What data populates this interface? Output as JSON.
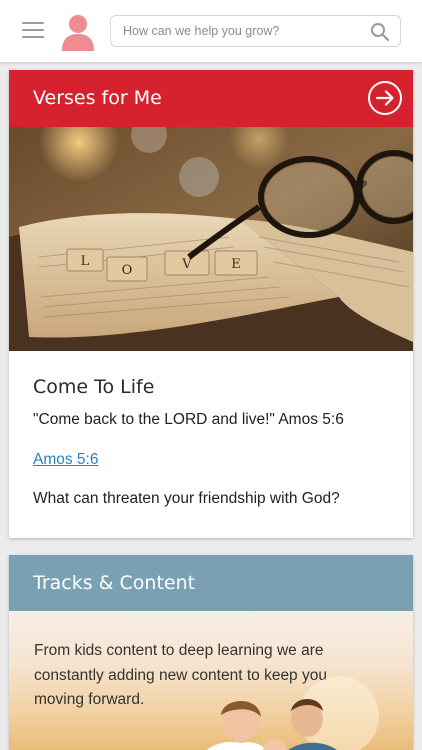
{
  "header": {
    "menu_icon": "hamburger-menu-icon",
    "avatar_icon": "user-avatar-icon",
    "search": {
      "placeholder": "How can we help you grow?",
      "icon": "search-icon"
    }
  },
  "verses_card": {
    "title": "Verses for Me",
    "arrow_icon": "arrow-right-circle-icon",
    "image": {
      "description_icon": "love-tiles-bible-glasses-photo",
      "tiles": [
        "L",
        "O",
        "V",
        "E"
      ]
    },
    "post_title": "Come To Life",
    "quote": "\"Come back to the LORD and live!\" Amos 5:6",
    "link_text": "Amos 5:6",
    "question": "What can threaten your friendship with God?"
  },
  "tracks_card": {
    "title": "Tracks & Content",
    "description": "From kids content to deep learning we are constantly adding new content to keep you moving forward."
  },
  "colors": {
    "verses_header": "#d6212f",
    "tracks_header": "#7aa0b4",
    "link": "#2a82c4",
    "avatar": "#ef8c8f"
  }
}
